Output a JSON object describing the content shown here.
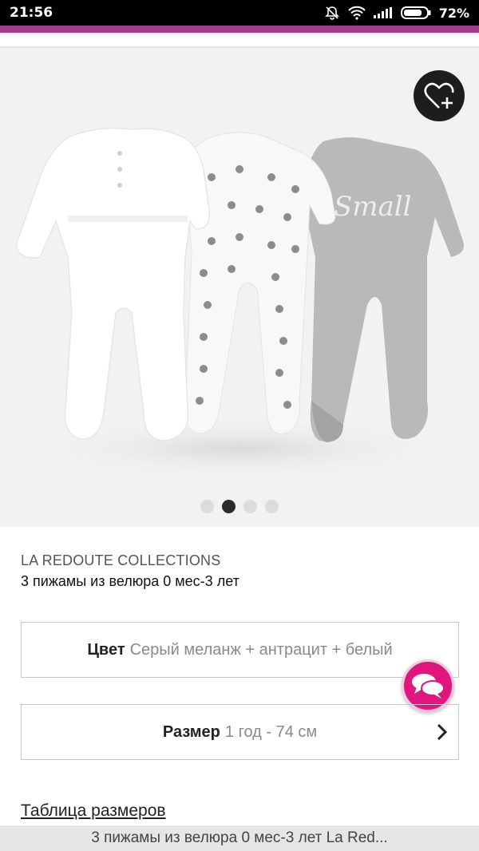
{
  "status_bar": {
    "time": "21:56",
    "battery": "72%",
    "icons": [
      "mute-icon",
      "wifi-icon",
      "signal-icon",
      "battery-icon"
    ]
  },
  "colors": {
    "promo_accent": "#a5398e",
    "chat_button": "#e0157e",
    "wishlist_button": "#1d1d1d"
  },
  "gallery": {
    "printed_text": "Small",
    "dot_count": 4,
    "active_dot": 2
  },
  "product": {
    "brand": "LA REDOUTE COLLECTIONS",
    "title": "3 пижамы из велюра 0 мес-3 лет"
  },
  "color_option": {
    "label": "Цвет",
    "value": "Серый меланж + антрацит + белый"
  },
  "size_option": {
    "label": "Размер",
    "value": "1 год - 74 см"
  },
  "size_table_link": "Таблица размеров",
  "bottom_bar": {
    "text": "3 пижамы из велюра 0 мес-3 лет La Red..."
  }
}
